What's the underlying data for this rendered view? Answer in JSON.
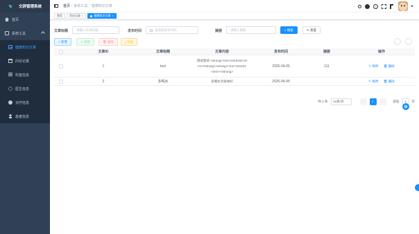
{
  "app": {
    "title": "文辞管理系统"
  },
  "sidebar": {
    "items": [
      {
        "label": "首页",
        "icon": "home-icon"
      },
      {
        "label": "系统工具",
        "icon": "system-icon"
      },
      {
        "label": "健康知识文章",
        "icon": "doc-icon",
        "active": true
      },
      {
        "label": "问诊记录",
        "icon": "calendar-icon"
      },
      {
        "label": "科室信息",
        "icon": "list-icon"
      },
      {
        "label": "医生信息",
        "icon": "gear-icon"
      },
      {
        "label": "诊疗信息",
        "icon": "lab-icon"
      },
      {
        "label": "患者信息",
        "icon": "user-icon"
      }
    ]
  },
  "navbar": {
    "breadcrumb": [
      "首页",
      "系统工具",
      "健康知识文章"
    ]
  },
  "tags": [
    {
      "label": "首页"
    },
    {
      "label": "问诊记录"
    },
    {
      "label": "健康知识文章"
    }
  ],
  "search": {
    "title_label": "文章标题",
    "title_placeholder": "请输入文章标题",
    "date_label": "发布时间",
    "date_placeholder": "请选择发布时间",
    "summary_label": "摘要",
    "summary_placeholder": "请输入摘要",
    "search_btn": "搜索",
    "reset_btn": "重置"
  },
  "toolbar": {
    "add": "+ 新增",
    "edit": "修改",
    "delete": "删除",
    "export": "导出"
  },
  "table": {
    "headers": [
      "文章ID",
      "文章标题",
      "文章内容",
      "发布时间",
      "摘要",
      "操作"
    ],
    "rows": [
      {
        "id": "1",
        "title": "test",
        "content_lines": [
          "测试测试 <strong><em>1616161</e",
          "m></strong><strong><em>131231",
          "</em></strong>"
        ],
        "date": "2025-04-05",
        "summary": "111"
      },
      {
        "id": "2",
        "title": "多喝水",
        "content_lines": [
          "多喝水对身体好"
        ],
        "date": "2025-04-05",
        "summary": ""
      }
    ],
    "op_edit": "修改",
    "op_delete": "删除"
  },
  "pagination": {
    "total": "共 2 条",
    "page_size": "10条/页",
    "current": "1",
    "goto_label": "前往",
    "goto_value": "1",
    "page_suffix": "页"
  },
  "colors": {
    "primary": "#1890ff",
    "sidebar": "#304156"
  }
}
